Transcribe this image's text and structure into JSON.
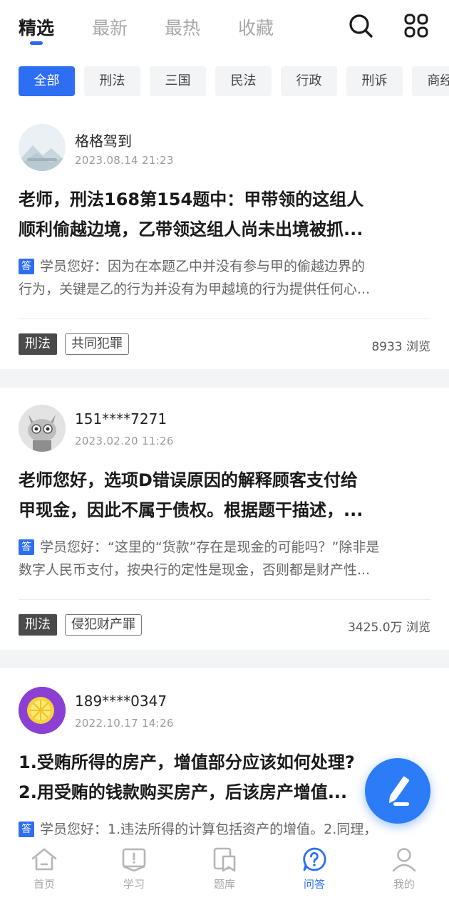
{
  "top_tabs": [
    {
      "label": "精选",
      "active": true
    },
    {
      "label": "最新",
      "active": false
    },
    {
      "label": "最热",
      "active": false
    },
    {
      "label": "收藏",
      "active": false
    }
  ],
  "icons": {
    "search": "search-icon",
    "grid": "grid-icon"
  },
  "categories": [
    "全部",
    "刑法",
    "三国",
    "民法",
    "行政",
    "刑诉",
    "商经"
  ],
  "answer_badge": "答",
  "posts": [
    {
      "user": "格格驾到",
      "datetime": "2023.08.14  21:23",
      "title_lines": [
        "老师，刑法168第154题中：甲带领的这组人",
        "顺利偷越边境，乙带领这组人尚未出境被抓..."
      ],
      "answer_lines": [
        "学员您好：因为在本题乙中并没有参与甲的偷越边界的",
        "行为，关键是乙的行为并没有为甲越境的行为提供任何心..."
      ],
      "subject": "刑法",
      "topic": "共同犯罪",
      "views": "8933 浏览"
    },
    {
      "user": "151****7271",
      "datetime": "2023.02.20  11:26",
      "title_lines": [
        "老师您好，选项D错误原因的解释顾客支付给",
        "甲现金，因此不属于债权。根据题干描述，..."
      ],
      "answer_lines": [
        "学员您好：“这里的“货款”存在是现金的可能吗？”除非是",
        "数字人民币支付，按央行的定性是现金，否则都是财产性..."
      ],
      "subject": "刑法",
      "topic": "侵犯财产罪",
      "views": "3425.0万 浏览"
    },
    {
      "user": "189****0347",
      "datetime": "2022.10.17  14:26",
      "title_lines": [
        "1.受贿所得的房产，增值部分应该如何处理?",
        "2.用受贿的钱款购买房产，后该房产增值..."
      ],
      "answer_lines": [
        "学员您好：1.违法所得的计算包括资产的增值。2.同理，",
        ""
      ],
      "subject": "",
      "topic": "",
      "views": ""
    }
  ],
  "bottom_nav": [
    {
      "label": "首页",
      "icon": "home-icon",
      "active": false
    },
    {
      "label": "学习",
      "icon": "book-icon",
      "active": false
    },
    {
      "label": "题库",
      "icon": "question-bank-icon",
      "active": false
    },
    {
      "label": "问答",
      "icon": "qa-icon",
      "active": true
    },
    {
      "label": "我的",
      "icon": "profile-icon",
      "active": false
    }
  ],
  "colors": {
    "accent": "#2d6ef3",
    "fab": "#2b7cf6",
    "tag_dark": "#4a4a4a"
  }
}
